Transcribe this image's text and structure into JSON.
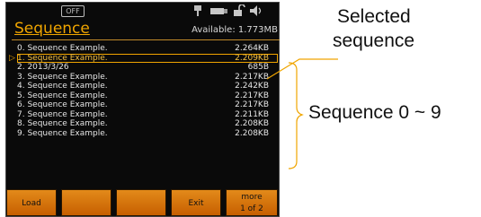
{
  "status": {
    "output_state": "OFF"
  },
  "header": {
    "title": "Sequence",
    "available": "Available: 1.773MB"
  },
  "sequences": [
    {
      "name": "0.  Sequence Example.",
      "size": "2.264KB"
    },
    {
      "name": "1.  Sequence Example.",
      "size": "2.209KB"
    },
    {
      "name": "2.  2013/3/26",
      "size": "685B"
    },
    {
      "name": "3.  Sequence Example.",
      "size": "2.217KB"
    },
    {
      "name": "4.  Sequence Example.",
      "size": "2.242KB"
    },
    {
      "name": "5.  Sequence Example.",
      "size": "2.217KB"
    },
    {
      "name": "6.  Sequence Example.",
      "size": "2.217KB"
    },
    {
      "name": "7.  Sequence Example.",
      "size": "2.211KB"
    },
    {
      "name": "8.  Sequence Example.",
      "size": "2.208KB"
    },
    {
      "name": "9.  Sequence Example.",
      "size": "2.208KB"
    }
  ],
  "selected_index": 1,
  "softkeys": {
    "load": "Load",
    "exit": "Exit",
    "more_line1": "more",
    "more_line2": "1  of  2"
  },
  "callouts": {
    "selected_line1": "Selected",
    "selected_line2": "sequence",
    "range": "Sequence 0 ~ 9"
  },
  "colors": {
    "accent": "#f0a500",
    "softkey": "#d97408",
    "screen_bg": "#0a0a0a"
  }
}
